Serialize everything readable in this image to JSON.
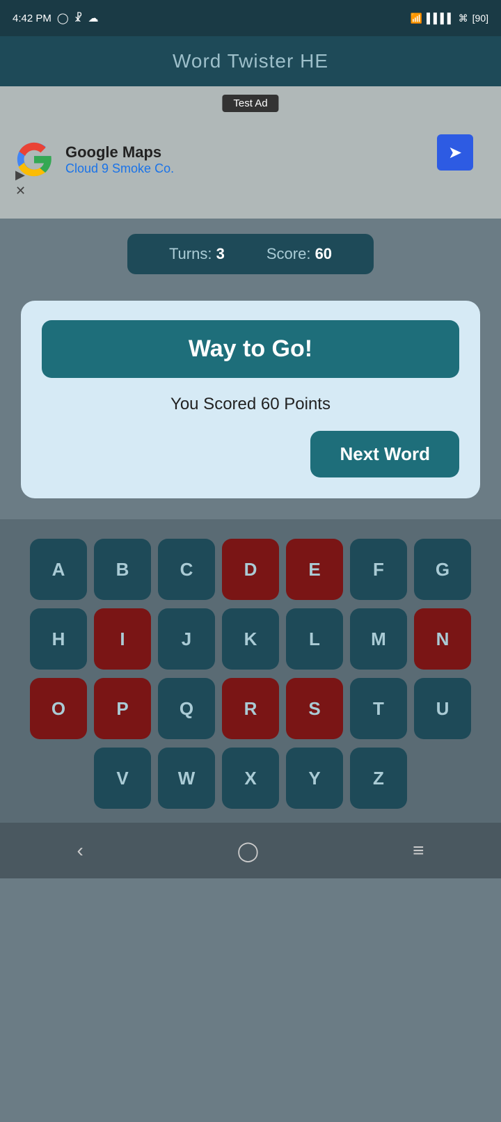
{
  "statusBar": {
    "time": "4:42 PM",
    "battery": "90"
  },
  "header": {
    "title": "Word Twister HE"
  },
  "ad": {
    "label": "Test Ad",
    "company": "Google Maps",
    "sub": "Cloud 9 Smoke Co."
  },
  "stats": {
    "turnsLabel": "Turns:",
    "turnsValue": "3",
    "scoreLabel": "Score:",
    "scoreValue": "60"
  },
  "modal": {
    "title": "Way to Go!",
    "scoreText": "You Scored 60 Points",
    "nextButtonLabel": "Next Word"
  },
  "keyboard": {
    "rows": [
      [
        "A",
        "B",
        "C",
        "D",
        "E",
        "F",
        "G"
      ],
      [
        "H",
        "I",
        "J",
        "K",
        "L",
        "M",
        "N"
      ],
      [
        "O",
        "P",
        "Q",
        "R",
        "S",
        "T",
        "U"
      ],
      [
        "V",
        "W",
        "X",
        "Y",
        "Z"
      ]
    ],
    "usedKeys": [
      "D",
      "E",
      "I",
      "N",
      "O",
      "P",
      "R",
      "S"
    ]
  },
  "navBar": {
    "back": "‹",
    "home": "○",
    "menu": "≡"
  }
}
